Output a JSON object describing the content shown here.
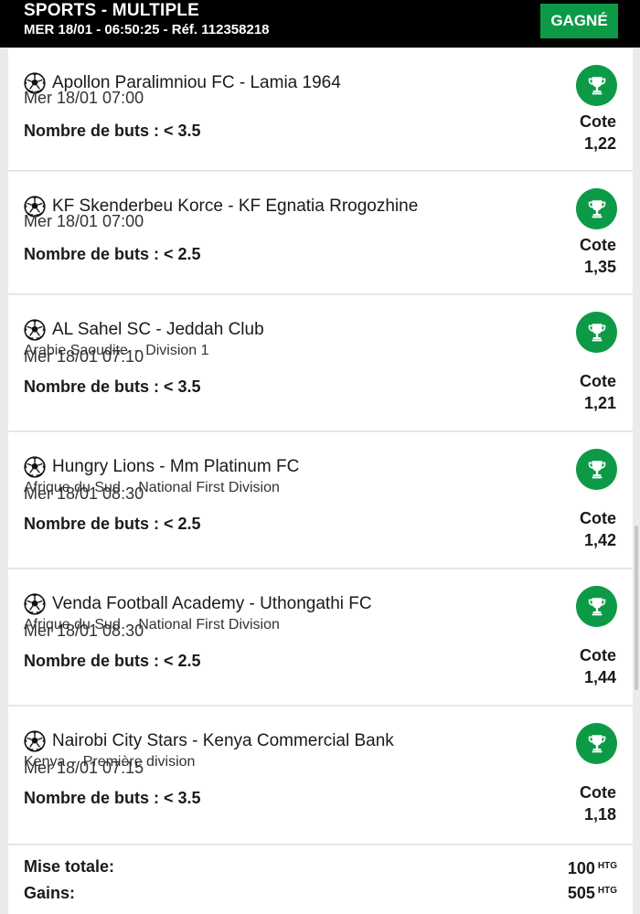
{
  "header": {
    "title": "SPORTS - MULTIPLE",
    "subtitle": "MER 18/01 - 06:50:25 - Réf. 112358218",
    "status": "GAGNÉ"
  },
  "colors": {
    "brand_green": "#0d9a47",
    "header_bg": "#000000"
  },
  "bets": [
    {
      "match": "Apollon Paralimniou FC - Lamia 1964",
      "country": "",
      "league": "",
      "date": "Mer 18/01 07:00",
      "bet": "Nombre de buts : < 3.5",
      "cote_label": "Cote",
      "cote": "1,22",
      "icon": "soccer-ball-icon",
      "result_icon": "trophy-icon"
    },
    {
      "match": "KF Skenderbeu Korce - KF Egnatia Rrogozhine",
      "country": "",
      "league": "",
      "date": "Mer 18/01 07:00",
      "bet": "Nombre de buts : < 2.5",
      "cote_label": "Cote",
      "cote": "1,35",
      "icon": "soccer-ball-icon",
      "result_icon": "trophy-icon"
    },
    {
      "match": "AL Sahel SC - Jeddah Club",
      "country": "Arabie Saoudite",
      "league": "Division 1",
      "date": "Mer 18/01 07:10",
      "bet": "Nombre de buts : < 3.5",
      "cote_label": "Cote",
      "cote": "1,21",
      "icon": "soccer-ball-icon",
      "result_icon": "trophy-icon"
    },
    {
      "match": "Hungry Lions - Mm Platinum FC",
      "country": "Afrique du Sud",
      "league": "National First Division",
      "date": "Mer 18/01 08:30",
      "bet": "Nombre de buts : < 2.5",
      "cote_label": "Cote",
      "cote": "1,42",
      "icon": "soccer-ball-icon",
      "result_icon": "trophy-icon"
    },
    {
      "match": "Venda Football Academy - Uthongathi FC",
      "country": "Afrique du Sud",
      "league": "National First Division",
      "date": "Mer 18/01 08:30",
      "bet": "Nombre de buts : < 2.5",
      "cote_label": "Cote",
      "cote": "1,44",
      "icon": "soccer-ball-icon",
      "result_icon": "trophy-icon"
    },
    {
      "match": "Nairobi City Stars - Kenya Commercial Bank",
      "country": "Kenya",
      "league": "Première division",
      "date": "Mer 18/01 07:15",
      "bet": "Nombre de buts : < 3.5",
      "cote_label": "Cote",
      "cote": "1,18",
      "icon": "soccer-ball-icon",
      "result_icon": "trophy-icon"
    }
  ],
  "footer": {
    "stake_label": "Mise totale:",
    "stake_value": "100",
    "winnings_label": "Gains:",
    "winnings_value": "505",
    "currency": "HTG"
  }
}
